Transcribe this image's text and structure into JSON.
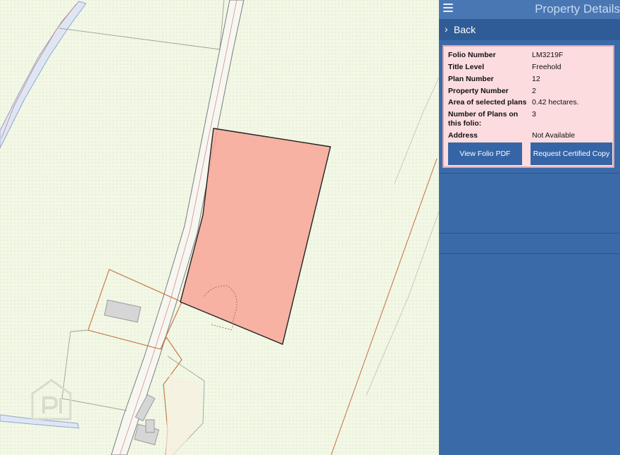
{
  "header": {
    "title": "Property Details",
    "menu_icon": "hamburger-menu-icon"
  },
  "nav": {
    "back_label": "Back",
    "back_icon": "chevron-right-icon"
  },
  "property": {
    "rows": [
      {
        "key": "Folio Number",
        "value": "LM3219F"
      },
      {
        "key": "Title Level",
        "value": "Freehold"
      },
      {
        "key": "Plan Number",
        "value": "12"
      },
      {
        "key": "Property Number",
        "value": "2"
      },
      {
        "key": "Area of selected plans",
        "value": "0.42 hectares."
      },
      {
        "key": "Number of Plans on this folio:",
        "value": "3"
      },
      {
        "key": "Address",
        "value": "Not Available"
      }
    ],
    "buttons": {
      "view_pdf": "View Folio PDF",
      "request_copy": "Request Certified Copy"
    }
  },
  "colors": {
    "panel": "#3b6aa8",
    "card_bg": "#fcdcdf",
    "card_border": "#e6a3aa",
    "button": "#3565a6",
    "parcel_fill": "#f7a89a",
    "map_bg": "#f3f7e6"
  },
  "map": {
    "watermark_icon": "pi-watermark-icon"
  }
}
